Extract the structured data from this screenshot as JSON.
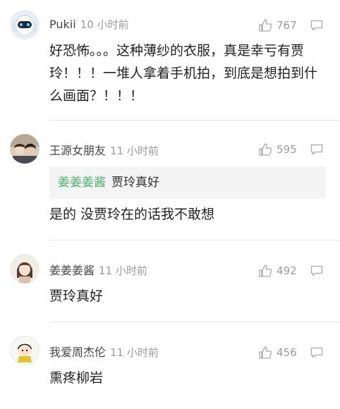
{
  "comments": [
    {
      "username": "Pukii",
      "time": "10 小时前",
      "likes": "767",
      "text": "好恐怖。。。这种薄纱的衣服，真是幸亏有贾玲！！！一堆人拿着手机拍，到底是想拍到什么画面？！！！"
    },
    {
      "username": "王源女朋友",
      "time": "11 小时前",
      "likes": "595",
      "quote": {
        "name": "姜姜姜酱",
        "text": "贾玲真好"
      },
      "text": "是的 没贾玲在的话我不敢想"
    },
    {
      "username": "姜姜姜酱",
      "time": "11 小时前",
      "likes": "492",
      "text": "贾玲真好"
    },
    {
      "username": "我爱周杰伦",
      "time": "11 小时前",
      "likes": "456",
      "text": "熏疼柳岩"
    }
  ],
  "colors": {
    "quote_name": "#4fae6e",
    "meta": "#9a9a9a",
    "divider": "#e6e6e6"
  },
  "icons": {
    "like": "thumbs-up-icon",
    "reply": "comment-bubble-icon"
  }
}
